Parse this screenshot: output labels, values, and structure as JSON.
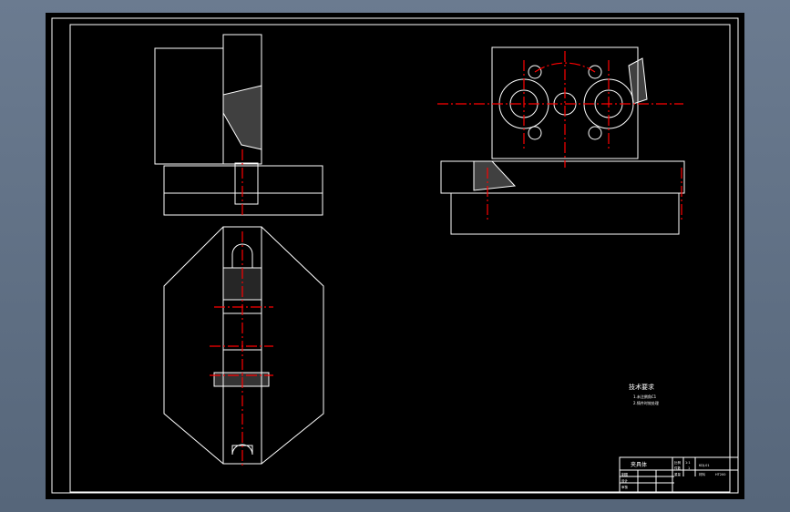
{
  "drawing": {
    "tech_requirements_title": "技术要求",
    "tech_requirements": [
      "1.未注倒角C1",
      "2.铸件时效处理"
    ],
    "title_block": {
      "part_name": "夹具体",
      "scale_label": "比例",
      "scale_value": "1:1",
      "count_label": "件数",
      "count_value": "1",
      "weight_label": "重量",
      "material_label": "材料",
      "material_value": "HT200",
      "drawing_no": "KDJ-01",
      "drawn_label": "制图",
      "design_label": "设计",
      "check_label": "审核"
    },
    "colors": {
      "line": "#ffffff",
      "center": "#ff0000",
      "background": "#000000"
    }
  }
}
